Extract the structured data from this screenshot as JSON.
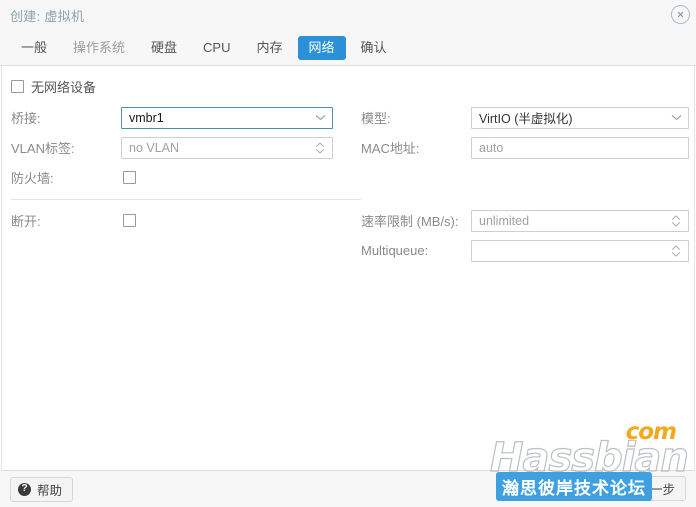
{
  "window": {
    "title": "创建: 虚拟机",
    "close_icon": "close-circle-icon"
  },
  "tabs": [
    {
      "label": "一般",
      "active": false
    },
    {
      "label": "操作系统",
      "active": false
    },
    {
      "label": "硬盘",
      "active": false
    },
    {
      "label": "CPU",
      "active": false
    },
    {
      "label": "内存",
      "active": false
    },
    {
      "label": "网络",
      "active": true
    },
    {
      "label": "确认",
      "active": false
    }
  ],
  "form": {
    "no_network_device": {
      "label": "无网络设备",
      "checked": false
    },
    "left": {
      "bridge": {
        "label": "桥接:",
        "value": "vmbr1",
        "focused": true,
        "control": "combobox"
      },
      "vlan_tag": {
        "label": "VLAN标签:",
        "value": "no VLAN",
        "placeholder": true,
        "control": "spinner"
      },
      "firewall": {
        "label": "防火墙:",
        "checked": false,
        "control": "checkbox"
      },
      "disconnect": {
        "label": "断开:",
        "checked": false,
        "control": "checkbox"
      }
    },
    "right": {
      "model": {
        "label": "模型:",
        "value": "VirtIO (半虚拟化)",
        "control": "combobox"
      },
      "mac_address": {
        "label": "MAC地址:",
        "value": "auto",
        "placeholder": true,
        "control": "text"
      },
      "rate_limit": {
        "label": "速率限制 (MB/s):",
        "value": "unlimited",
        "placeholder": true,
        "control": "spinner"
      },
      "multiqueue": {
        "label": "Multiqueue:",
        "value": "",
        "control": "spinner"
      }
    }
  },
  "footer": {
    "help_label": "帮助",
    "help_icon": "question-mark-icon",
    "next_label": "下一步"
  },
  "watermark": {
    "brand": "Hassbian",
    "tld": "com",
    "band": "瀚思彼岸技术论坛"
  },
  "colors": {
    "accent": "#2a90d8",
    "title": "#8aa2b4",
    "label": "#8a8a8a",
    "field_border": "#cfcfcf",
    "focus_border": "#4f8fa8",
    "watermark_band": "#3fa0e0",
    "watermark_tld": "#f4a81d"
  }
}
